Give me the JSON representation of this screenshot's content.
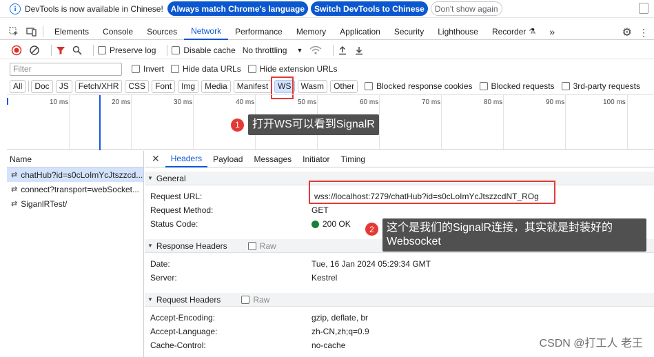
{
  "banner": {
    "message": "DevTools is now available in Chinese!",
    "btn_match": "Always match Chrome's language",
    "btn_switch": "Switch DevTools to Chinese",
    "btn_dismiss": "Don't show again"
  },
  "tabs": [
    "Elements",
    "Console",
    "Sources",
    "Network",
    "Performance",
    "Memory",
    "Application",
    "Security",
    "Lighthouse",
    "Recorder"
  ],
  "toolbar": {
    "preserve_log": "Preserve log",
    "disable_cache": "Disable cache",
    "throttling": "No throttling"
  },
  "filter": {
    "placeholder": "Filter",
    "invert": "Invert",
    "hide_data_urls": "Hide data URLs",
    "hide_extension_urls": "Hide extension URLs"
  },
  "types": [
    "All",
    "Doc",
    "JS",
    "Fetch/XHR",
    "CSS",
    "Font",
    "Img",
    "Media",
    "Manifest",
    "WS",
    "Wasm",
    "Other"
  ],
  "type_checks": [
    "Blocked response cookies",
    "Blocked requests",
    "3rd-party requests"
  ],
  "timeline": {
    "labels": [
      "10 ms",
      "20 ms",
      "30 ms",
      "40 ms",
      "50 ms",
      "60 ms",
      "70 ms",
      "80 ms",
      "90 ms",
      "100 ms"
    ]
  },
  "annotations": {
    "a1_num": "1",
    "a1_text": "打开WS可以看到SignalR",
    "a2_num": "2",
    "a2_line1": "这个是我们的SignalR连接，其实就是封装好的",
    "a2_line2": "Websocket"
  },
  "requests": {
    "header": "Name",
    "rows": [
      "chatHub?id=s0cLoImYcJtszzcd...",
      "connect?transport=webSocket...",
      "SiganlRTest/"
    ]
  },
  "detail": {
    "tabs": [
      "Headers",
      "Payload",
      "Messages",
      "Initiator",
      "Timing"
    ],
    "general": {
      "title": "General",
      "request_url_k": "Request URL:",
      "request_url_v": "wss://localhost:7279/chatHub?id=s0cLoImYcJtszzcdNT_ROg",
      "method_k": "Request Method:",
      "method_v": "GET",
      "status_k": "Status Code:",
      "status_v": "200 OK"
    },
    "response_headers": {
      "title": "Response Headers",
      "raw": "Raw",
      "date_k": "Date:",
      "date_v": "Tue, 16 Jan 2024 05:29:34 GMT",
      "server_k": "Server:",
      "server_v": "Kestrel"
    },
    "request_headers": {
      "title": "Request Headers",
      "raw": "Raw",
      "enc_k": "Accept-Encoding:",
      "enc_v": "gzip, deflate, br",
      "lang_k": "Accept-Language:",
      "lang_v": "zh-CN,zh;q=0.9",
      "cache_k": "Cache-Control:",
      "cache_v": "no-cache"
    }
  },
  "watermark": "CSDN @打工人 老王"
}
